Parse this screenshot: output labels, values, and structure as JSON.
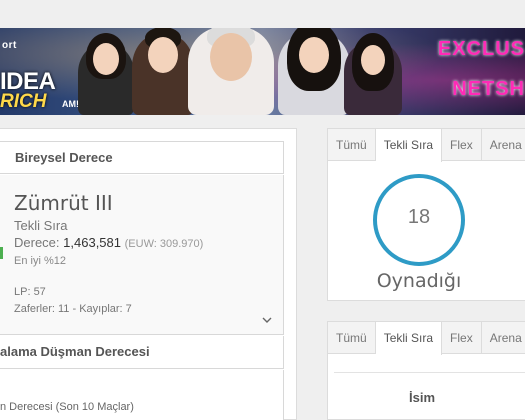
{
  "banner": {
    "brand_top": "ort",
    "brand_idea": "IDEA",
    "brand_rich": "RICH",
    "brand_am": "AM!",
    "promo_line1": "EXCLUS",
    "promo_line2": "NETSH"
  },
  "ranked": {
    "header": "Bireysel Derece",
    "tier": "Zümrüt III",
    "queue": "Tekli Sıra",
    "points_label": "Derece:",
    "points_value": "1,463,581",
    "region_rank": "(EUW: 309.970)",
    "best": "En iyi %12",
    "lp": "LP: 57",
    "record": "Zaferler: 11 - Kayıplar: 7"
  },
  "average": {
    "header": "alama Düşman Derecesi",
    "sub": "n Derecesi (Son 10 Maçlar)"
  },
  "played_panel": {
    "tabs": [
      "Tümü",
      "Tekli Sıra",
      "Flex",
      "Arena"
    ],
    "active_tab": 1,
    "count": "18",
    "label": "Oynadığı"
  },
  "champ_panel": {
    "tabs": [
      "Tümü",
      "Tekli Sıra",
      "Flex",
      "Arena"
    ],
    "active_tab": 1,
    "column_name": "İsim"
  },
  "colors": {
    "ring": "#2e9bc6",
    "accent_green": "#4caf50",
    "promo_pink": "#ff2bb7"
  }
}
